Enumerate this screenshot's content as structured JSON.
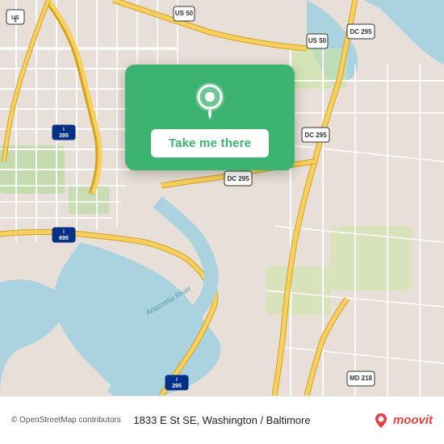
{
  "map": {
    "background_color": "#e8e0d8",
    "alt": "Map of Washington DC area showing 1833 E St SE"
  },
  "location_card": {
    "button_label": "Take me there",
    "pin_icon": "location-pin"
  },
  "bottom_bar": {
    "attribution": "© OpenStreetMap contributors",
    "address": "1833 E St SE, Washington / Baltimore",
    "logo_text": "moovit"
  }
}
